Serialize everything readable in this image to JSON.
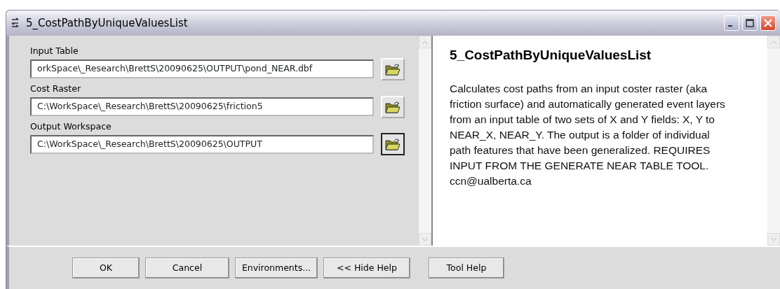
{
  "window": {
    "title": "5_CostPathByUniqueValuesList"
  },
  "parameters": [
    {
      "label": "Input Table",
      "value": "orkSpace\\_Research\\BrettS\\20090625\\OUTPUT\\pond_NEAR.dbf",
      "focused": false
    },
    {
      "label": "Cost Raster",
      "value": "C:\\WorkSpace\\_Research\\BrettS\\20090625\\friction5",
      "focused": false
    },
    {
      "label": "Output Workspace",
      "value": "C:\\WorkSpace\\_Research\\BrettS\\20090625\\OUTPUT",
      "focused": true
    }
  ],
  "help": {
    "title": "5_CostPathByUniqueValuesList",
    "text": "Calculates cost paths from an input coster raster (aka friction surface) and automatically generated event layers from an input table of two sets of X and Y fields: X, Y to NEAR_X, NEAR_Y. The output is a folder of individual path features that have been generalized. REQUIRES INPUT FROM THE GENERATE NEAR TABLE TOOL. ccn@ualberta.ca"
  },
  "buttons": [
    "OK",
    "Cancel",
    "Environments...",
    "<< Hide Help",
    "Tool Help"
  ]
}
